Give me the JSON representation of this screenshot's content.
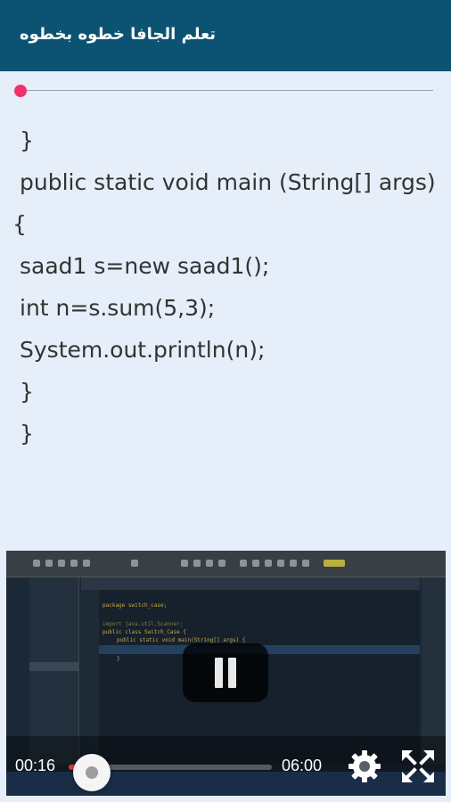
{
  "app": {
    "title": "تعلم الجافا خطوه بخطوه"
  },
  "audio_seek": {
    "progress": 0.0,
    "accent": "#f0326b"
  },
  "code_lines": [
    "}",
    "public static void main (String[] args)",
    "{",
    "saad1 s=new saad1();",
    "int n=s.sum(5,3);",
    "System.out.println(n);",
    "}",
    "}"
  ],
  "video": {
    "current_time": "00:16",
    "duration": "06:00",
    "progress": 0.044,
    "state": "playing",
    "icons": [
      "pause-icon",
      "gear-icon",
      "fullscreen-icon"
    ],
    "screen_code": [
      "package switch_case;",
      "import java.util.Scanner;",
      "public class Switch_Case {",
      "public static void main(String[] args) {",
      "}"
    ]
  }
}
